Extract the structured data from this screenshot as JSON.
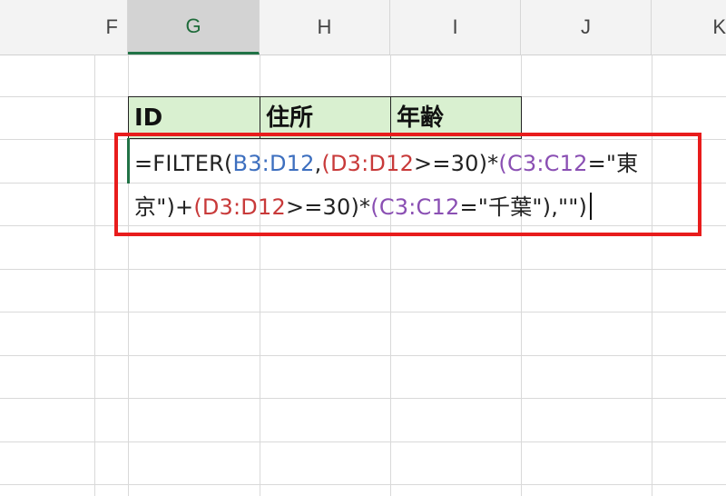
{
  "columns": [
    "F",
    "G",
    "H",
    "I",
    "J",
    "K"
  ],
  "table_header": [
    "ID",
    "住所",
    "年齢"
  ],
  "formula": {
    "line1": [
      {
        "text": "=FILTER(",
        "color": "default"
      },
      {
        "text": "B3:D12",
        "color": "blue"
      },
      {
        "text": ",",
        "color": "default"
      },
      {
        "text": "(D3:D12",
        "color": "red"
      },
      {
        "text": ">=30)*",
        "color": "default"
      },
      {
        "text": "(C3:C12",
        "color": "purple"
      },
      {
        "text": "=\"東",
        "color": "default"
      }
    ],
    "line2": [
      {
        "text": "京\")+",
        "color": "default"
      },
      {
        "text": "(D3:D12",
        "color": "red"
      },
      {
        "text": ">=30)*",
        "color": "default"
      },
      {
        "text": "(C3:C12",
        "color": "purple"
      },
      {
        "text": "=\"千葉\"),\"\")",
        "color": "default"
      }
    ]
  },
  "colors": {
    "blue": "#3d6fbf",
    "red": "#c83a3a",
    "purple": "#8a4fb3",
    "highlight_box": "#e81c1c",
    "header_fill": "#d9f0d0",
    "selected_col": "#217346"
  }
}
